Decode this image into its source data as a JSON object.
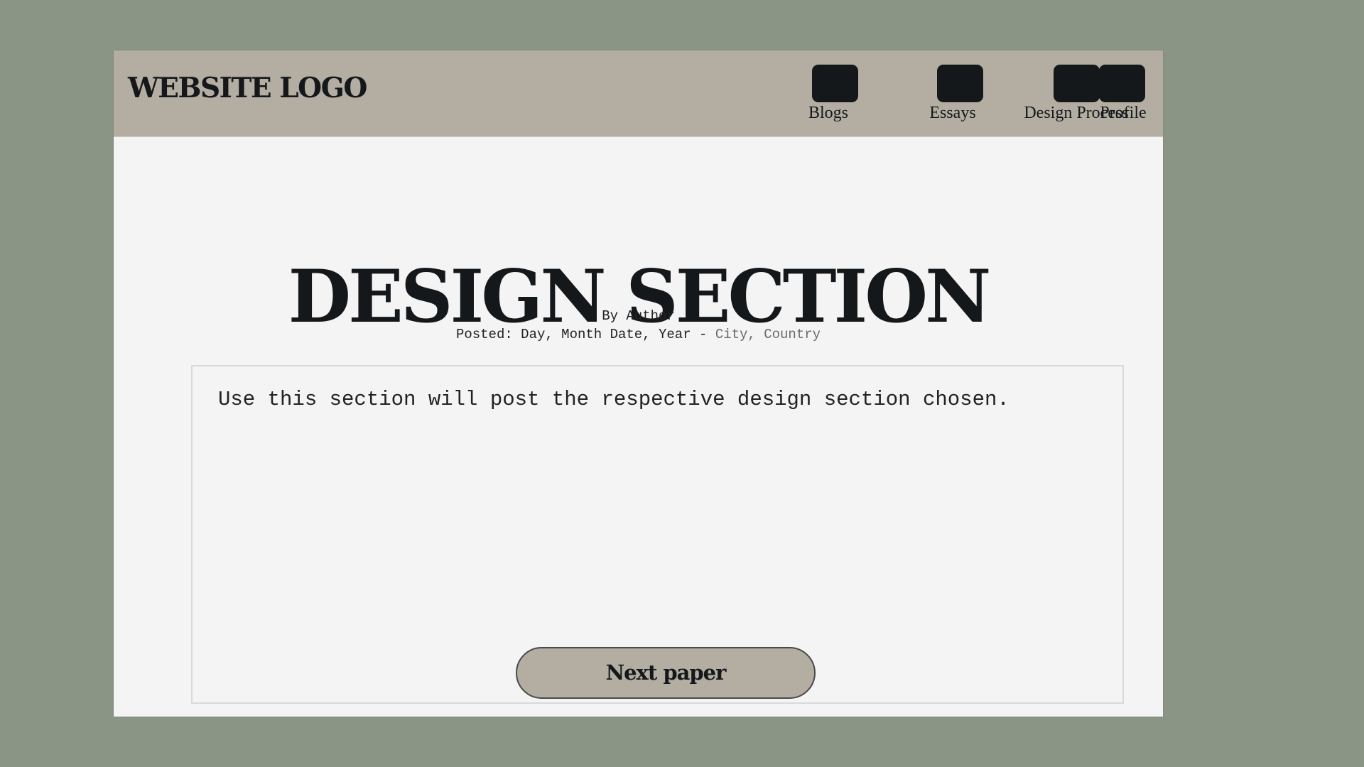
{
  "header": {
    "logo": "WEBSITE LOGO",
    "nav": [
      {
        "label": "Blogs",
        "icon": "blogs-icon"
      },
      {
        "label": "Essays",
        "icon": "essays-icon"
      },
      {
        "label": "Design Process",
        "icon": "design-process-icon"
      },
      {
        "label": "Profile",
        "icon": "profile-icon"
      }
    ]
  },
  "main": {
    "title": "DESIGN SECTION",
    "byline": "By Author",
    "posted_prefix": "Posted: Day, Month Date, Year - ",
    "posted_location": "City, Country",
    "content_text": "Use this section will post the respective design section chosen.",
    "next_button": "Next paper"
  },
  "colors": {
    "background": "#8a9586",
    "header": "#b3ada2",
    "page": "#f4f4f4",
    "text": "#15181b",
    "button": "#b3ada2"
  }
}
